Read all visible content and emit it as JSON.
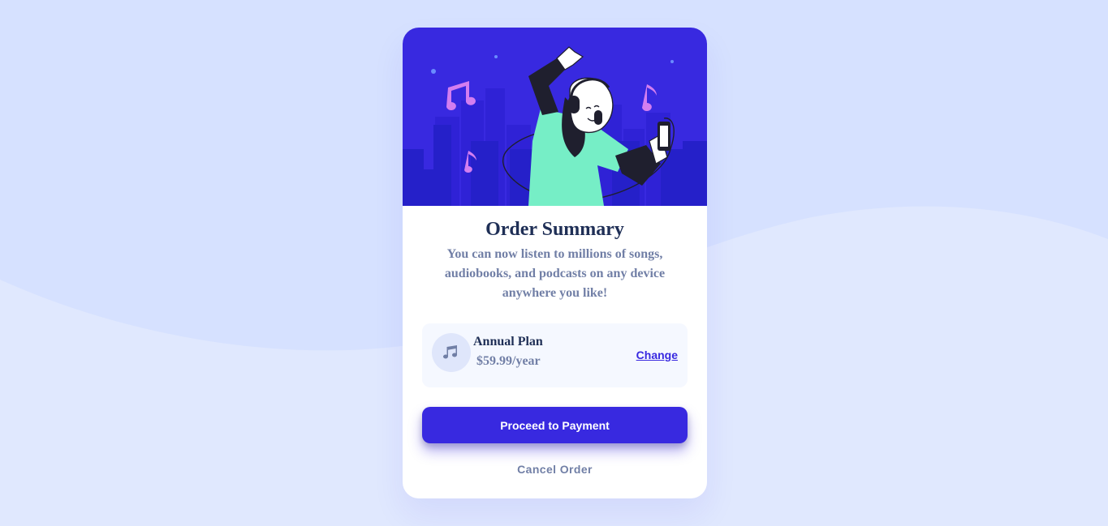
{
  "card": {
    "title": "Order Summary",
    "description": "You can now listen to millions of songs, audiobooks, and podcasts on any device anywhere you like!"
  },
  "plan": {
    "icon": "music-note-icon",
    "name": "Annual Plan",
    "price": "$59.99/year",
    "change_label": "Change"
  },
  "actions": {
    "proceed_label": "Proceed to Payment",
    "cancel_label": "Cancel Order"
  },
  "colors": {
    "background": "#e0e8fe",
    "wave": "#d6e1ff",
    "primary": "#3829e0",
    "hero_bg": "#3829e0",
    "dark_text": "#1f2f56",
    "muted_text": "#717fa6",
    "plan_bg": "#f5f8ff"
  }
}
